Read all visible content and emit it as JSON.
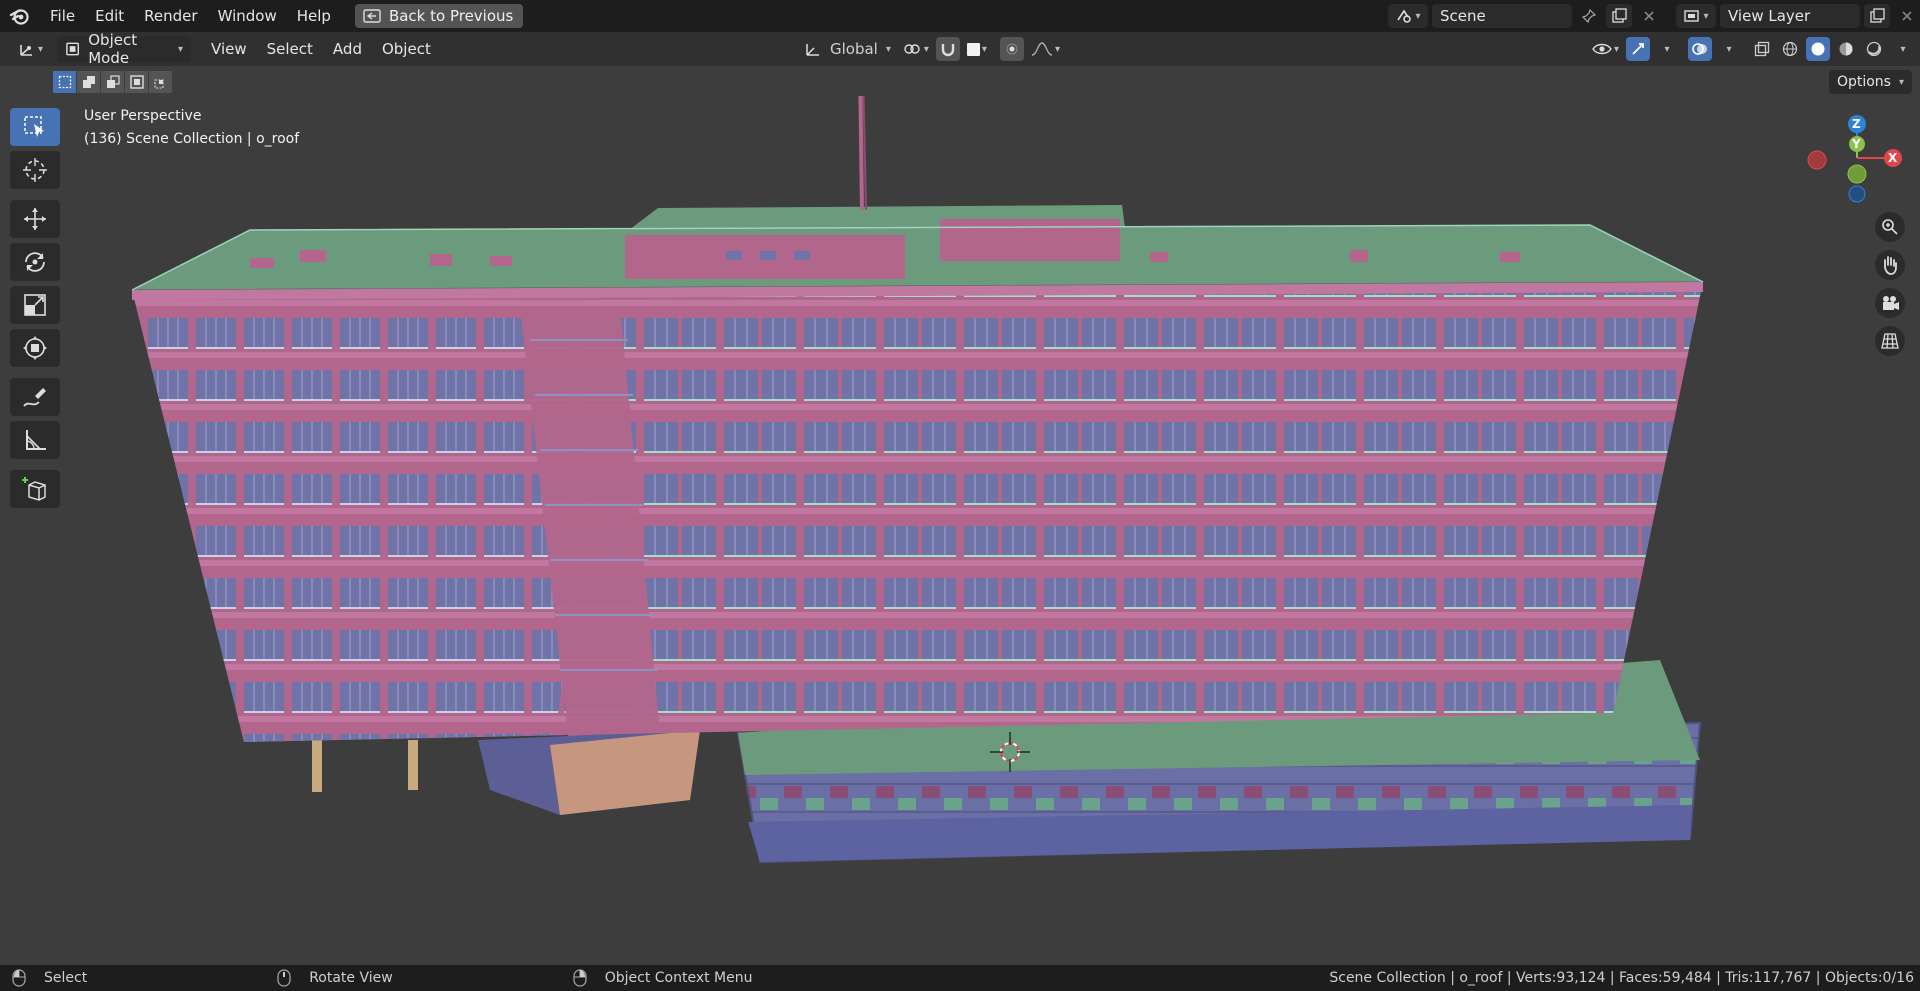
{
  "topbar": {
    "menus": [
      "File",
      "Edit",
      "Render",
      "Window",
      "Help"
    ],
    "back_label": "Back to Previous",
    "scene_name": "Scene",
    "view_layer_name": "View Layer"
  },
  "header": {
    "mode_label": "Object Mode",
    "menus": [
      "View",
      "Select",
      "Add",
      "Object"
    ],
    "orientation_label": "Global",
    "options_label": "Options"
  },
  "viewport": {
    "perspective_label": "User Perspective",
    "collection_label": "(136) Scene Collection | o_roof",
    "gizmo_axes": {
      "z": "Z",
      "y": "Y",
      "x": "X"
    }
  },
  "statusbar": {
    "select_label": "Select",
    "rotate_label": "Rotate View",
    "context_label": "Object Context Menu",
    "stats": "Scene Collection | o_roof | Verts:93,124 | Faces:59,484 | Tris:117,767 | Objects:0/16"
  },
  "colors": {
    "accent": "#4772b3",
    "wall": "#b2668c",
    "roof": "#6c9a7c",
    "glass": "#6b6fa0",
    "axis_x": "#e0474c",
    "axis_y": "#8bc34a",
    "axis_z": "#2f82d6"
  }
}
